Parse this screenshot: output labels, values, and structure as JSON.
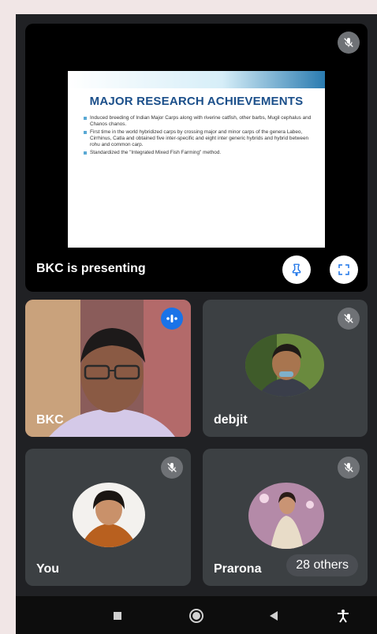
{
  "presentation": {
    "slide_title": "MAJOR RESEARCH ACHIEVEMENTS",
    "slide_bullets": [
      "Induced breeding of Indian Major Carps along with riverine catfish, other barbs, Mugil cephalus and Chanos chanos.",
      "First time in the world hybridized carps by crossing major and minor carps of the genera Labeo, Cirrhinus, Catla and obtained five inter-specific and eight inter generic hybrids and hybrid between rohu and common carp.",
      "Standardized the \"Integrated Mixed Fish Farming\" method."
    ],
    "presenting_label": "BKC is presenting"
  },
  "participants": [
    {
      "name": "BKC",
      "status": "speaking"
    },
    {
      "name": "debjit",
      "status": "muted"
    },
    {
      "name": "You",
      "status": "muted"
    },
    {
      "name": "Prarona",
      "status": "muted"
    }
  ],
  "others_label": "28 others",
  "icons": {
    "mute": "mic-off-icon",
    "pin": "pin-icon",
    "fullscreen": "fullscreen-icon",
    "speaking": "audio-level-icon"
  },
  "nav": [
    "recents-icon",
    "home-icon",
    "back-icon",
    "accessibility-icon"
  ],
  "colors": {
    "background": "#202124",
    "tile": "#3c4043",
    "accent": "#1a73e8",
    "slide_title": "#1b4f8a"
  }
}
